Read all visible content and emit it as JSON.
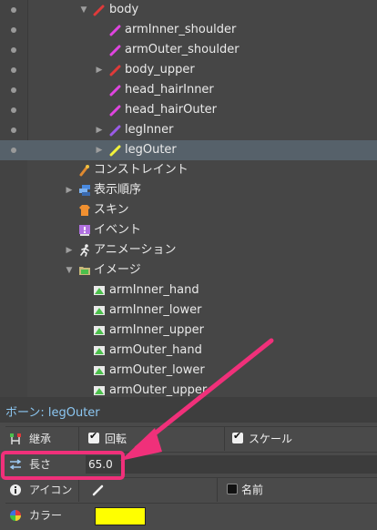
{
  "tree": {
    "rows": [
      {
        "label": "body",
        "icon": "bone-icon",
        "color": "#e03a3a",
        "arrow": "▼"
      },
      {
        "label": "armInner_shoulder",
        "icon": "bone-icon",
        "color": "#e045e0",
        "arrow": ""
      },
      {
        "label": "armOuter_shoulder",
        "icon": "bone-icon",
        "color": "#e045e0",
        "arrow": ""
      },
      {
        "label": "body_upper",
        "icon": "bone-icon",
        "color": "#e03a3a",
        "arrow": "▶"
      },
      {
        "label": "head_hairInner",
        "icon": "bone-icon",
        "color": "#e045e0",
        "arrow": ""
      },
      {
        "label": "head_hairOuter",
        "icon": "bone-icon",
        "color": "#e045e0",
        "arrow": ""
      },
      {
        "label": "legInner",
        "icon": "bone-icon",
        "color": "#9b5be8",
        "arrow": "▶"
      },
      {
        "label": "legOuter",
        "icon": "bone-icon",
        "color": "#f2f23a",
        "arrow": "▶"
      },
      {
        "label": "コンストレイント",
        "icon": "constraint-icon",
        "color": "#e08a30",
        "arrow": ""
      },
      {
        "label": "表示順序",
        "icon": "draw-order-icon",
        "color": "#4a8ae0",
        "arrow": "▶"
      },
      {
        "label": "スキン",
        "icon": "skin-icon",
        "color": "#f09030",
        "arrow": ""
      },
      {
        "label": "イベント",
        "icon": "event-icon",
        "color": "#b070e0",
        "arrow": ""
      },
      {
        "label": "アニメーション",
        "icon": "animation-icon",
        "color": "#e8e8e8",
        "arrow": "▶"
      },
      {
        "label": "イメージ",
        "icon": "folder-icon",
        "color": "#c9b97a",
        "arrow": "▼"
      },
      {
        "label": "armInner_hand",
        "icon": "image-icon",
        "color": "#4cc04c",
        "arrow": ""
      },
      {
        "label": "armInner_lower",
        "icon": "image-icon",
        "color": "#4cc04c",
        "arrow": ""
      },
      {
        "label": "armInner_upper",
        "icon": "image-icon",
        "color": "#4cc04c",
        "arrow": ""
      },
      {
        "label": "armOuter_hand",
        "icon": "image-icon",
        "color": "#4cc04c",
        "arrow": ""
      },
      {
        "label": "armOuter_lower",
        "icon": "image-icon",
        "color": "#4cc04c",
        "arrow": ""
      },
      {
        "label": "armOuter_upper",
        "icon": "image-icon",
        "color": "#4cc04c",
        "arrow": ""
      }
    ]
  },
  "panel": {
    "title": "ボーン: legOuter"
  },
  "props": {
    "inherit_label": "継承",
    "rotation_label": "回転",
    "scale_label": "スケール",
    "length_label": "長さ",
    "length_value": "65.0",
    "icon_label": "アイコン",
    "name_label": "名前",
    "color_label": "カラー",
    "color_value": "#ffff00"
  }
}
